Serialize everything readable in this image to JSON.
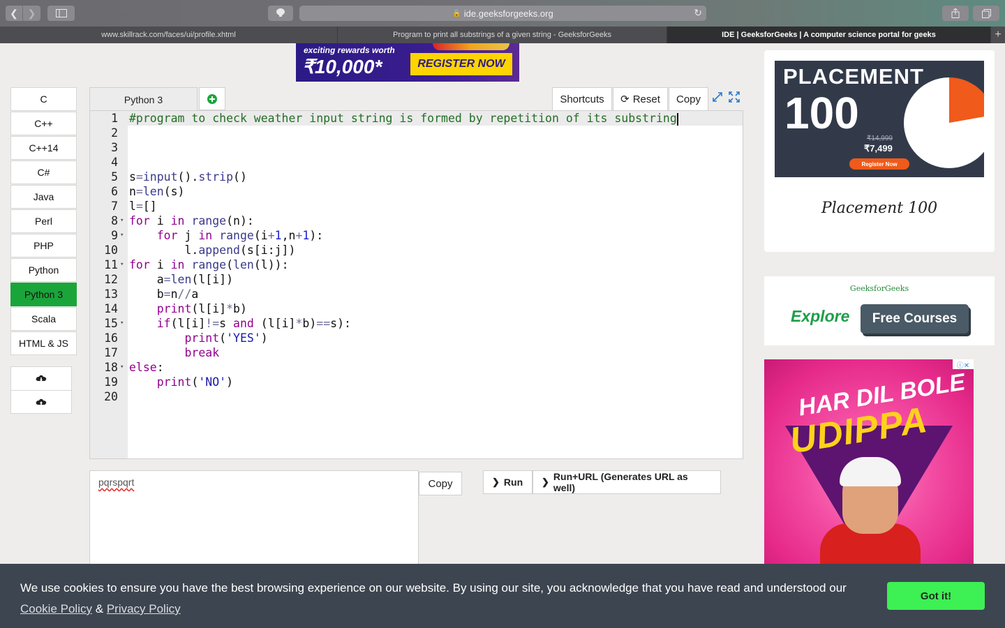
{
  "browser": {
    "address": "ide.geeksforgeeks.org",
    "tabs": [
      {
        "label": "www.skillrack.com/faces/ui/profile.xhtml",
        "active": false
      },
      {
        "label": "Program to print all substrings of a given string - GeeksforGeeks",
        "active": false
      },
      {
        "label": "IDE | GeeksforGeeks | A computer science portal for geeks",
        "active": true
      }
    ],
    "new_tab": "+"
  },
  "top_ad": {
    "line1": "exciting rewards worth",
    "amount": "₹10,000*",
    "cta": "REGISTER NOW"
  },
  "languages": [
    "C",
    "C++",
    "C++14",
    "C#",
    "Java",
    "Perl",
    "PHP",
    "Python",
    "Python 3",
    "Scala",
    "HTML & JS"
  ],
  "active_language": "Python 3",
  "editor": {
    "tab_label": "Python 3",
    "buttons": {
      "shortcuts": "Shortcuts",
      "reset": "Reset",
      "copy": "Copy"
    },
    "lines": [
      "#program to check weather input string is formed by repetition of its substring",
      "",
      "",
      "",
      "s=input().strip()",
      "n=len(s)",
      "l=[]",
      "for i in range(n):",
      "    for j in range(i+1,n+1):",
      "        l.append(s[i:j])",
      "for i in range(len(l)):",
      "    a=len(l[i])",
      "    b=n//a",
      "    print(l[i]*b)",
      "    if(l[i]!=s and (l[i]*b)==s):",
      "        print('YES')",
      "        break",
      "else:",
      "    print('NO')",
      ""
    ],
    "fold_lines": [
      8,
      9,
      11,
      15,
      18
    ]
  },
  "stdin": {
    "value": "pqrspqrt"
  },
  "io_buttons": {
    "copy": "Copy",
    "run": "Run",
    "run_url": "Run+URL (Generates URL as well)"
  },
  "ads": {
    "placement": {
      "title": "PLACEMENT",
      "number": "100",
      "old_price": "₹14,999",
      "price": "₹7,499",
      "cta": "Register Now",
      "caption": "Placement 100"
    },
    "courses": {
      "brand": "GeeksforGeeks",
      "explore": "Explore",
      "cta": "Free Courses"
    },
    "udippa": {
      "line1": "HAR DIL BOLE",
      "line2": "UDIPPA"
    }
  },
  "cookie": {
    "text": "We use cookies to ensure you have the best browsing experience on our website. By using our site, you acknowledge that you have read and understood our",
    "cookie_policy": "Cookie Policy",
    "amp": "&",
    "privacy_policy": "Privacy Policy",
    "button": "Got it!"
  },
  "colors": {
    "active_language": "#1aa53b",
    "cookie_bar": "#3d4550",
    "got_it": "#3df054"
  }
}
